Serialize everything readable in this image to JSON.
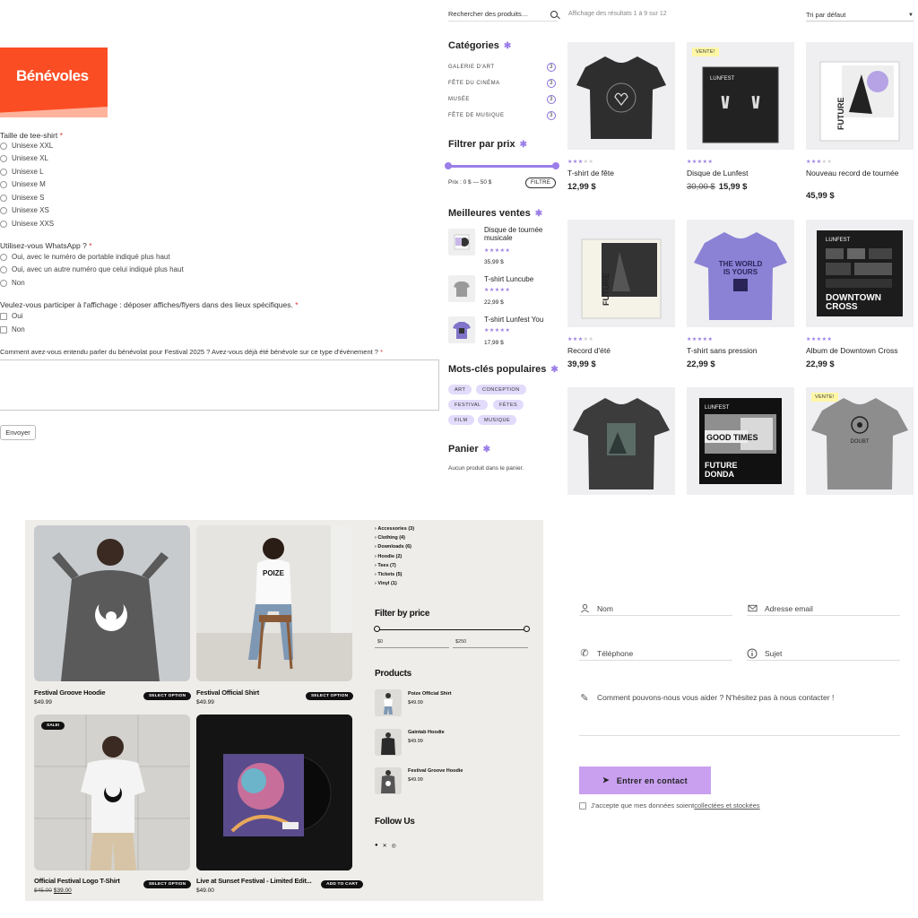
{
  "volunteer_form": {
    "badge_title": "Bénévoles",
    "tshirt_question": "Taille de tee-shirt",
    "required_mark": "*",
    "sizes": [
      "Unisexe XXL",
      "Unisexe XL",
      "Unisexe L",
      "Unisexe M",
      "Unisexe S",
      "Unisexe XS",
      "Unisexe XXS"
    ],
    "whatsapp_question": "Utilisez-vous WhatsApp ?",
    "whatsapp_options": [
      "Oui, avec le numéro de portable indiqué plus haut",
      "Oui, avec un autre numéro que celui indiqué plus haut",
      "Non"
    ],
    "poster_question": "Veulez-vous participer à l'affichage : déposer affiches/flyers dans des lieux spécifiques.",
    "poster_options": [
      "Oui",
      "Non"
    ],
    "heard_question": "Comment avez-vous entendu parler du bénévolat pour Festival 2025 ? Avez-vous déjà été bénévole sur ce type d'évènement ?",
    "send_label": "Envoyer"
  },
  "shop_sidebar": {
    "search_placeholder": "Rechercher des produits…",
    "categories_title": "Catégories",
    "categories": [
      {
        "label": "GALERIE D'ART",
        "count": "3"
      },
      {
        "label": "FÊTE DU CINÉMA",
        "count": "3"
      },
      {
        "label": "MUSÉE",
        "count": "3"
      },
      {
        "label": "FÊTE DE MUSIQUE",
        "count": "3"
      }
    ],
    "price_filter_title": "Filtrer par prix",
    "price_text": "Prix : 0 $ — 50 $",
    "price_range": {
      "min": 0,
      "max": 50,
      "selected_min": 0,
      "selected_max": 50
    },
    "filter_button": "FILTRE",
    "best_sellers_title": "Meilleures ventes",
    "best_sellers": [
      {
        "name": "Disque de tournée musicale",
        "stars": "★★★★★",
        "price": "35,99 $"
      },
      {
        "name": "T-shirt Luncube",
        "stars": "★★★★★",
        "price": "22,99 $"
      },
      {
        "name": "T-shirt Lunfest You",
        "stars": "★★★★★",
        "price": "17,99 $"
      }
    ],
    "tags_title": "Mots-clés populaires",
    "tags": [
      "ART",
      "CONCEPTION",
      "FESTIVAL",
      "FÊTES",
      "FILM",
      "MUSIQUE"
    ],
    "cart_title": "Panier",
    "cart_empty": "Aucun produit dans le panier."
  },
  "product_grid": {
    "results_text": "Affichage des résultats 1 à 9 sur 12",
    "sort_label": "Tri par défaut",
    "sale_badge": "VENTE!",
    "products": [
      {
        "name": "T-shirt de fête",
        "price": "12,99 $",
        "old_price": "",
        "rating": 3
      },
      {
        "name": "Disque de Lunfest",
        "price": "15,99 $",
        "old_price": "30,00 $",
        "rating": 5
      },
      {
        "name": "Nouveau record de tournée",
        "price": "45,99 $",
        "old_price": "",
        "rating": 3
      },
      {
        "name": "Record d'été",
        "price": "39,99 $",
        "old_price": "",
        "rating": 3
      },
      {
        "name": "T-shirt sans pression",
        "price": "22,99 $",
        "old_price": "",
        "rating": 5
      },
      {
        "name": "Album de Downtown Cross",
        "price": "22,99 $",
        "old_price": "",
        "rating": 5
      }
    ],
    "image_texts": {
      "p5_line1": "THE WORLD",
      "p5_line2": "IS YOURS",
      "p6_brand": "LUNFEST",
      "p6_line1": "DOWNTOWN",
      "p6_line2": "CROSS",
      "p8_brand": "LUNFEST",
      "p8_line1": "GOOD TIMES",
      "p8_line2": "FUTURE",
      "p8_line3": "DONDA",
      "p3_text": "FUTURE",
      "p4_text": "FUTURE",
      "p9_text": "DOUBT"
    }
  },
  "shop2": {
    "products": [
      {
        "name": "Festival Groove Hoodie",
        "price": "$49.99",
        "button": "SELECT OPTION"
      },
      {
        "name": "Festival Official Shirt",
        "price": "$49.99",
        "button": "SELECT OPTION"
      },
      {
        "name": "Official Festival Logo T-Shirt",
        "old_price": "$45.00",
        "price": "$39.00",
        "button": "SELECT OPTION",
        "badge": "SALE!"
      },
      {
        "name": "Live at Sunset Festival - Limited Edit...",
        "price": "$49.00",
        "button": "ADD TO CART"
      }
    ],
    "categories": [
      "Accessories (3)",
      "Clothing (4)",
      "Downloads (6)",
      "Hoodie (2)",
      "Tees (7)",
      "Tickets (5)",
      "Vinyl (1)"
    ],
    "filter_title": "Filter by price",
    "min_price": "$0",
    "max_price": "$250",
    "products_title": "Products",
    "product_list": [
      {
        "name": "Poize Official Shirt",
        "price": "$49.99"
      },
      {
        "name": "Gaintab Hoodie",
        "price": "$49.99"
      },
      {
        "name": "Festival Groove Hoodie",
        "price": "$49.99"
      }
    ],
    "follow_title": "Follow Us",
    "social_icons": [
      "facebook-icon",
      "x-icon",
      "instagram-icon"
    ],
    "shirt_print": "POIZE"
  },
  "contact_form": {
    "name_placeholder": "Nom",
    "email_placeholder": "Adresse email",
    "phone_placeholder": "Téléphone",
    "subject_placeholder": "Sujet",
    "message_placeholder": "Comment pouvons-nous vous aider ? N'hésitez pas à nous contacter !",
    "submit_label": "Entrer en contact",
    "consent_text": "J'accepte que mes données soient",
    "consent_link": "collectées et stockées"
  },
  "colors": {
    "badge_red": "#fb4d24",
    "accent_purple": "#9b7ee8",
    "tag_bg": "#e2dbfb",
    "sale_yellow": "#fff7a6",
    "contact_button": "#c9a0ef",
    "shop2_bg": "#eeedea"
  }
}
